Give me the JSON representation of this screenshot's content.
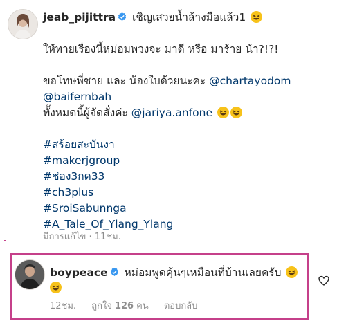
{
  "post": {
    "username": "jeab_pijittra",
    "caption_first": "เชิญเสวยน้ำล้างมือแล้ว1",
    "line2": "ให้ทายเรื่องนี้หม่อมพวงจะ มาดี หรือ มาร้าย น้า?!?!",
    "line3_text": "ขอโทษพี่ชาย และ น้องใบด้วยนะคะ",
    "mention1": "@chartayodom",
    "mention2": "@baifernbah",
    "line5_text": "ทั้งหมดนี้ผู้จัดสั่งค่ะ",
    "mention3": "@jariya.anfone",
    "hashtags": [
      "#สร้อยสะบันงา",
      "#makerjgroup",
      "#ช่อง3กด33",
      "#ch3plus",
      "#SroiSabunnga",
      "#A_Tale_Of_Ylang_Ylang"
    ],
    "meta": "มีการแก้ไข · 11ชม."
  },
  "reply": {
    "username": "boypeace",
    "text": "หม่อมพูดคุ้นๆเหมือนที่บ้านเลยครับ",
    "time": "12ชม.",
    "likes_prefix": "ถูกใจ",
    "likes_count": "126",
    "likes_suffix": "คน",
    "reply_label": "ตอบกลับ"
  },
  "icons": {
    "verified": "verified-badge-icon",
    "emoji": "grinning-squinting-face-emoji",
    "heart": "heart-outline-icon"
  },
  "colors": {
    "verified": "#3897f0",
    "link": "#00376b",
    "meta": "#8e8e8e",
    "highlight": "#c5408a",
    "emoji": "#f7c21a"
  }
}
